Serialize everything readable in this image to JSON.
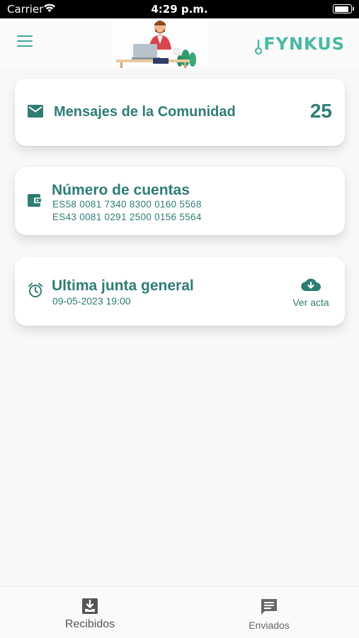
{
  "status_bar": {
    "carrier": "Carrier",
    "time": "4:29 p.m.",
    "battery_level": 0.9
  },
  "header": {
    "logo_text": "FYNKUS"
  },
  "cards": {
    "messages": {
      "title": "Mensajes de la Comunidad",
      "count": "25"
    },
    "accounts": {
      "title": "Número de cuentas",
      "items": [
        "ES58 0081 7340 8300 0160 5568",
        "ES43 0081 0291 2500 0156 5564"
      ]
    },
    "meeting": {
      "title": "Ultima junta general",
      "date": "09-05-2023 19:00",
      "action_label": "Ver acta"
    }
  },
  "tabs": [
    {
      "label": "Recibidos",
      "icon": "inbox-download-icon",
      "active": true
    },
    {
      "label": "Enviados",
      "icon": "chat-icon",
      "active": false
    }
  ],
  "colors": {
    "accent": "#2e7d74",
    "logo": "#4bb8a4"
  }
}
